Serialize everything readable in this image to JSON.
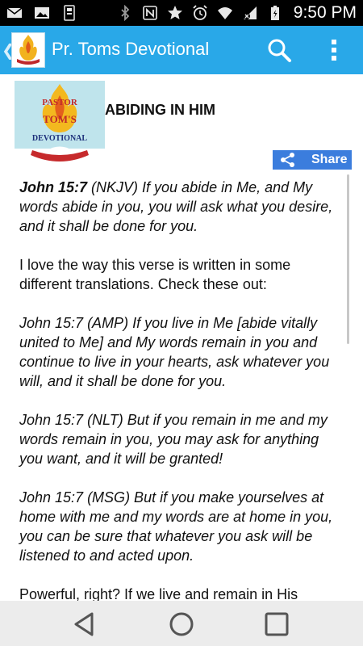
{
  "status_bar": {
    "time": "9:50 PM",
    "left_icons": [
      "mail-icon",
      "image-icon",
      "phone-storage-icon"
    ],
    "right_icons": [
      "bluetooth-icon",
      "nfc-icon",
      "star-icon",
      "alarm-icon",
      "wifi-icon",
      "signal-icon",
      "battery-icon"
    ]
  },
  "action_bar": {
    "title": "Pr. Toms Devotional",
    "logo_lines": [
      "PASTOR",
      "TOM'S",
      "DEVOTIONAL"
    ],
    "search_icon": "search-icon",
    "overflow_icon": "more-vertical-icon",
    "color": "#29a8e8"
  },
  "post": {
    "logo_lines": [
      "PASTOR",
      "TOM'S",
      "DEVOTIONAL"
    ],
    "title": "ABIDING IN HIM",
    "share_label": "Share",
    "paragraphs": [
      {
        "ref": "John 15:7",
        "text": " (NKJV) If you abide in Me, and My words abide in you, you will ask what you desire, and it shall be done for you.",
        "style": "italic"
      },
      {
        "ref": "",
        "text": "I love the way this verse is written in some different translations.  Check these out:",
        "style": "normal"
      },
      {
        "ref": "",
        "text": "John 15:7 (AMP) If you live in Me [abide vitally united to Me] and My words remain in you and continue to live in your hearts, ask whatever you will, and it shall be done for you.",
        "style": "italic"
      },
      {
        "ref": "",
        "text": "John 15:7 (NLT) But if you remain in me and my words remain in you, you may ask for anything you want, and it will be granted!",
        "style": "italic"
      },
      {
        "ref": "",
        "text": "John 15:7 (MSG) But if you make yourselves at home with me and my words are at home in you, you can be sure that whatever you ask will be listened to and acted upon.",
        "style": "italic"
      },
      {
        "ref": "",
        "text": "Powerful, right?  If we live and remain in His",
        "style": "normal"
      }
    ]
  },
  "nav_bar": {
    "buttons": [
      "back-triangle-icon",
      "home-circle-icon",
      "recents-square-icon"
    ]
  }
}
